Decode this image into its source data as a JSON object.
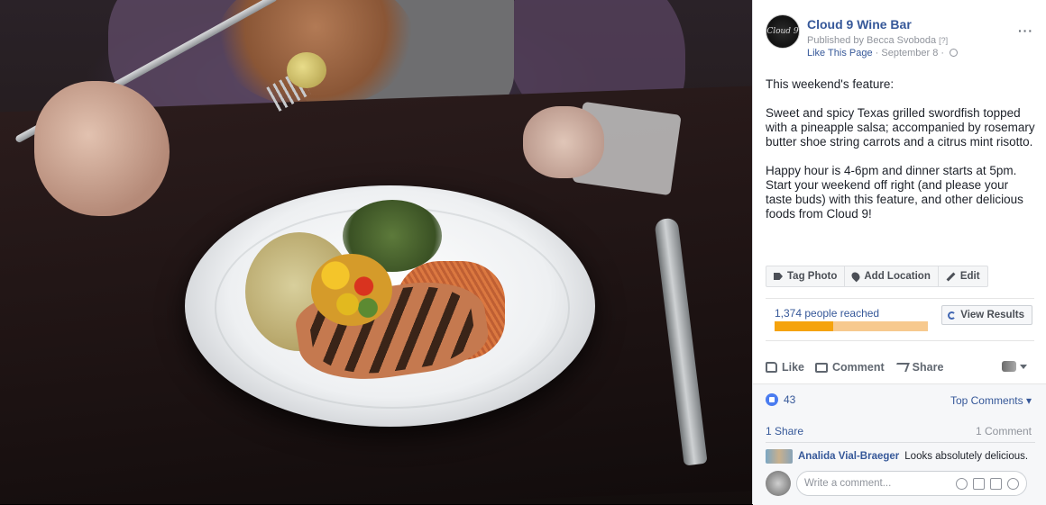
{
  "post": {
    "page_name": "Cloud 9 Wine Bar",
    "avatar_text": "Cloud 9",
    "published_by": "Published by Becca Svoboda",
    "published_help": "[?]",
    "like_page": "Like This Page",
    "date": "September 8",
    "separator": "·",
    "more": "···",
    "paragraphs": [
      "This weekend's feature:",
      "Sweet and spicy Texas grilled swordfish topped with a pineapple salsa; accompanied by rosemary butter shoe string carrots and a citrus mint risotto.",
      "Happy hour is 4-6pm and dinner starts at 5pm. Start your weekend off right (and please your taste buds) with this feature, and other delicious foods from Cloud 9!"
    ]
  },
  "tools": {
    "tag_photo": "Tag Photo",
    "add_location": "Add Location",
    "edit": "Edit"
  },
  "reach": {
    "text": "1,374 people reached",
    "organic_fraction": 0.38,
    "view_results": "View Results"
  },
  "actions": {
    "like": "Like",
    "comment": "Comment",
    "share": "Share"
  },
  "reactions": {
    "count": "43",
    "top_comments": "Top Comments ▾",
    "shares": "1 Share",
    "comments": "1 Comment"
  },
  "comment": {
    "author": "Analida Vial-Braeger",
    "text": "Looks absolutely delicious."
  },
  "write_comment": {
    "placeholder": "Write a comment..."
  }
}
